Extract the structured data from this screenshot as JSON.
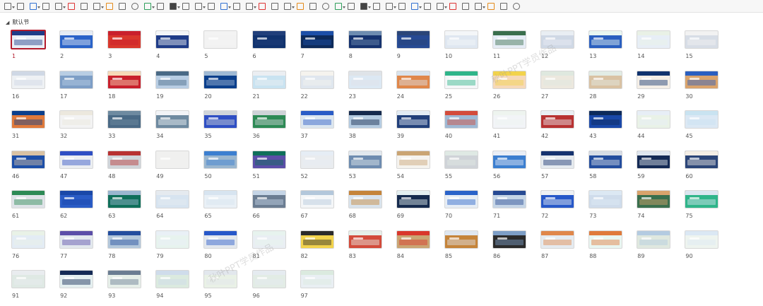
{
  "section": {
    "title": "默认节"
  },
  "selected_slide": 1,
  "slide_count": 97,
  "watermark": "秋叶PPT学员作品",
  "toolbar_icons": [
    "shape-fill-icon",
    "shape-outline-icon",
    "crop-icon",
    "group-icon",
    "bring-forward-icon",
    "send-backward-icon",
    "align-icon",
    "align-left-icon",
    "align-center-icon",
    "align-right-icon",
    "align-top-icon",
    "align-middle-icon",
    "align-bottom-icon",
    "distribute-icon",
    "rotate-icon",
    "flip-icon",
    "picture-icon",
    "chart-icon",
    "table-icon",
    "text-box-icon",
    "shape-icon",
    "border-icon",
    "font-color-icon",
    "bold-icon",
    "line-spacing-icon",
    "image-icon",
    "smartart-icon",
    "link-icon",
    "comment-icon",
    "layout-icon",
    "layer-icon",
    "arrange-icon",
    "equation-icon",
    "symbol-icon",
    "wordart-icon",
    "add-in-icon",
    "eraser-icon",
    "ellipse-icon",
    "circle-icon",
    "paint-icon",
    "arrow-icon"
  ],
  "palette": [
    "#e9eef6",
    "#2a63c9",
    "#d9372c",
    "#1f3c88",
    "#f2f2f2",
    "#11336e",
    "#0d2a5a",
    "#16336f",
    "#274a93",
    "#dfe7f1",
    "#e5ecf5",
    "#cfd8e5",
    "#2a5fc0",
    "#e7eef6",
    "#d7dde6",
    "#eef1f4",
    "#7d9ec6",
    "#c9202c",
    "#b8cde3",
    "#0b3f8c",
    "#c9e3f1",
    "#dfe6ee",
    "#dce8f3",
    "#e0874a",
    "#f4f6f8",
    "#f6d9b8",
    "#ece8de",
    "#d9c2a3",
    "#f4eee6",
    "#d9a36c",
    "#e07a3b",
    "#f3f3f3",
    "#4a6a86",
    "#6e8aa0",
    "#2f4fc4",
    "#2d8a55",
    "#dbe6f0",
    "#b4cbe1",
    "#213f7a",
    "#9fb9d4",
    "#f2f4f7",
    "#b83232",
    "#1a48a8",
    "#e9f2e7",
    "#dbe8f4",
    "#1d4fa8",
    "#ebeef2",
    "#d0d5da",
    "#f0f0ef",
    "#9ab6cf",
    "#5b4ea8",
    "#e9ecef",
    "#6e8cb0",
    "#f5f3ee",
    "#cfd3d8",
    "#3c7fd0",
    "#e5eaef",
    "#234d9e",
    "#142a55",
    "#2b4578",
    "#dfe3e8",
    "#2a5cc6",
    "#0f6f5a",
    "#d7e4f0",
    "#e9f0f6",
    "#6b7d92",
    "#f4f6f8",
    "#d9e3ec",
    "#152a4d",
    "#e6edf5",
    "#c5d5e6",
    "#2758c9",
    "#cfdceb",
    "#3a6f4d",
    "#2fb58a",
    "#e3ecf4",
    "#e2e8ee",
    "#b3c7db",
    "#e7f3ee",
    "#e2e7ed",
    "#e9eef3",
    "#f2d34c",
    "#d34b3b",
    "#caa573",
    "#c5843a",
    "#2b2b2b",
    "#e5ebf0",
    "#e9f6f1",
    "#dfe8df",
    "#eef4ef",
    "#dfe9e4",
    "#e4eff0",
    "#e6efe9",
    "#dbeadf",
    "#e9f1e6",
    "#e2ece5",
    "#e9eff3"
  ]
}
